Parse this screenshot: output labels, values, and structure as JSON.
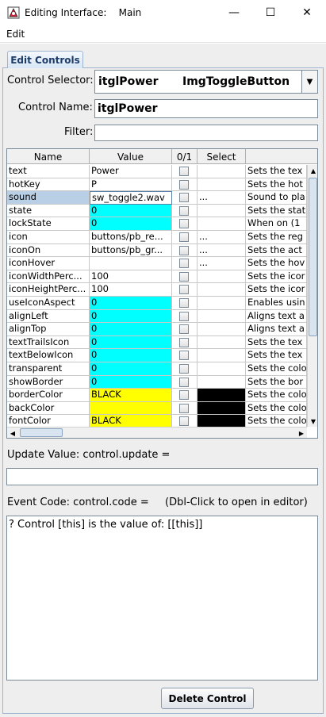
{
  "window": {
    "title": "Editing Interface:    Main",
    "minimize_glyph": "—",
    "maximize_glyph": "☐",
    "close_glyph": "✕"
  },
  "menu": {
    "edit": "Edit"
  },
  "tabs": [
    {
      "label": "Edit Controls"
    }
  ],
  "control_selector": {
    "label": "Control Selector:",
    "name": "itglPower",
    "type": "ImgToggleButton",
    "arrow": "▼"
  },
  "control_name": {
    "label": "Control Name:",
    "value": "itglPower"
  },
  "filter": {
    "label": "Filter:",
    "value": ""
  },
  "table": {
    "headers": [
      "Name",
      "Value",
      "0/1",
      "Select",
      ""
    ],
    "rows": [
      {
        "name": "text",
        "value": "Power",
        "select": "",
        "desc": "Sets the tex",
        "value_color": ""
      },
      {
        "name": "hotKey",
        "value": "P",
        "select": "",
        "desc": "Sets the hot",
        "value_color": ""
      },
      {
        "name": "sound",
        "value": "sw_toggle2.wav",
        "select": "...",
        "desc": "Sound to pla",
        "value_color": ""
      },
      {
        "name": "state",
        "value": "0",
        "select": "",
        "desc": "Sets the stat",
        "value_color": "#00ffff"
      },
      {
        "name": "lockState",
        "value": "0",
        "select": "",
        "desc": "When on (1",
        "value_color": "#00ffff"
      },
      {
        "name": "icon",
        "value": "buttons/pb_re...",
        "select": "...",
        "desc": "Sets the reg",
        "value_color": ""
      },
      {
        "name": "iconOn",
        "value": "buttons/pb_gr...",
        "select": "...",
        "desc": "Sets the act",
        "value_color": ""
      },
      {
        "name": "iconHover",
        "value": "",
        "select": "...",
        "desc": "Sets the hov",
        "value_color": ""
      },
      {
        "name": "iconWidthPerc...",
        "value": "100",
        "select": "",
        "desc": "Sets the icor",
        "value_color": ""
      },
      {
        "name": "iconHeightPerc...",
        "value": "100",
        "select": "",
        "desc": "Sets the icor",
        "value_color": ""
      },
      {
        "name": "useIconAspect",
        "value": "0",
        "select": "",
        "desc": "Enables usin",
        "value_color": "#00ffff"
      },
      {
        "name": "alignLeft",
        "value": "0",
        "select": "",
        "desc": "Aligns text a",
        "value_color": "#00ffff"
      },
      {
        "name": "alignTop",
        "value": "0",
        "select": "",
        "desc": "Aligns text a",
        "value_color": "#00ffff"
      },
      {
        "name": "textTrailsIcon",
        "value": "0",
        "select": "",
        "desc": "Sets the tex",
        "value_color": "#00ffff"
      },
      {
        "name": "textBelowIcon",
        "value": "0",
        "select": "",
        "desc": "Sets the tex",
        "value_color": "#00ffff"
      },
      {
        "name": "transparent",
        "value": "0",
        "select": "",
        "desc": "Sets the colo",
        "value_color": "#00ffff"
      },
      {
        "name": "showBorder",
        "value": "0",
        "select": "",
        "desc": "Sets the bor",
        "value_color": "#00ffff"
      },
      {
        "name": "borderColor",
        "value": "BLACK",
        "select": "...",
        "desc": "Sets the colo",
        "value_color": "#ffff00",
        "select_color": "#000000"
      },
      {
        "name": "backColor",
        "value": "",
        "select": "...",
        "desc": "Sets the colo",
        "value_color": "#ffff00",
        "select_color": "#000000"
      },
      {
        "name": "fontColor",
        "value": "BLACK",
        "select": "...",
        "desc": "Sets the colo",
        "value_color": "#ffff00",
        "select_color": "#000000"
      }
    ],
    "selected_row": 2
  },
  "update": {
    "label": "Update Value: control.update =",
    "value": ""
  },
  "event": {
    "label": "Event Code: control.code =",
    "hint": "(Dbl-Click to open in editor)",
    "code": "? Control [this] is the value of: [[this]]"
  },
  "buttons": {
    "delete": "Delete Control"
  }
}
